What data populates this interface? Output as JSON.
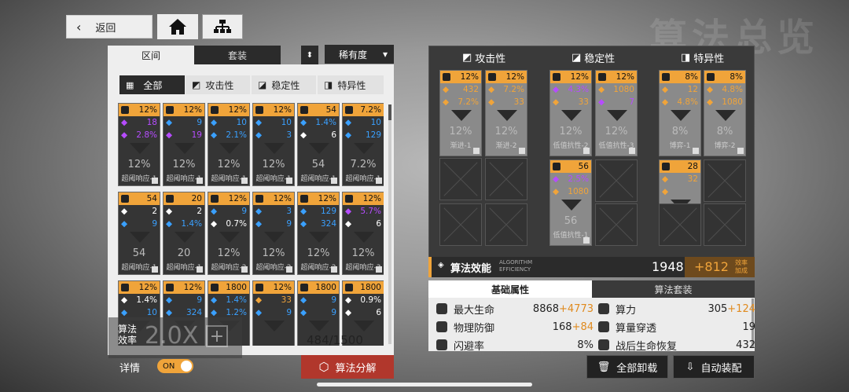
{
  "bg_title": "算法总览",
  "nav": {
    "back_label": "返回"
  },
  "left": {
    "tabs": [
      "区间",
      "套装"
    ],
    "sort_label": "稀有度",
    "filters": [
      "全部",
      "攻击性",
      "稳定性",
      "特异性"
    ],
    "count": "484/1500",
    "detail_label": "详情",
    "toggle_label": "ON",
    "decompose_label": "算法分解",
    "boost_label": "算法效率",
    "boost_value": "2.0X"
  },
  "cards": [
    {
      "h": "12%",
      "l1": "18",
      "l2": "2.8%",
      "big": "12%",
      "name": "超阈响应-1"
    },
    {
      "h": "12%",
      "l1": "9",
      "l2": "19",
      "big": "12%",
      "name": "超阈响应-1"
    },
    {
      "h": "12%",
      "l1": "10",
      "l2": "2.1%",
      "big": "12%",
      "name": "超阈响应-1"
    },
    {
      "h": "12%",
      "l1": "10",
      "l2": "3",
      "big": "12%",
      "name": "超阈响应-1"
    },
    {
      "h": "54",
      "l1": "1.4%",
      "l2": "6",
      "big": "54",
      "name": "超阈响应-1"
    },
    {
      "h": "7.2%",
      "l1": "10",
      "l2": "129",
      "big": "7.2%",
      "name": "超阈响应-1"
    },
    {
      "h": "54",
      "l1": "2",
      "l2": "9",
      "big": "54",
      "name": "超阈响应-1"
    },
    {
      "h": "20",
      "l1": "2",
      "l2": "1.4%",
      "big": "20",
      "name": "超阈响应-1"
    },
    {
      "h": "12%",
      "l1": "9",
      "l2": "0.7%",
      "big": "12%",
      "name": "超阈响应-2"
    },
    {
      "h": "12%",
      "l1": "3",
      "l2": "9",
      "big": "12%",
      "name": "超阈响应-2"
    },
    {
      "h": "12%",
      "l1": "129",
      "l2": "324",
      "big": "12%",
      "name": "超阈响应-2"
    },
    {
      "h": "12%",
      "l1": "5.7%",
      "l2": "6",
      "big": "12%",
      "name": "超阈响应-3"
    },
    {
      "h": "12%",
      "l1": "1.4%",
      "l2": "10",
      "big": "",
      "name": ""
    },
    {
      "h": "12%",
      "l1": "9",
      "l2": "324",
      "big": "",
      "name": ""
    },
    {
      "h": "1800",
      "l1": "1.4%",
      "l2": "1.2%",
      "big": "",
      "name": ""
    },
    {
      "h": "12%",
      "l1": "33",
      "l2": "9",
      "big": "",
      "name": ""
    },
    {
      "h": "1800",
      "l1": "9",
      "l2": "9",
      "big": "",
      "name": ""
    },
    {
      "h": "1800",
      "l1": "0.9%",
      "l2": "6",
      "big": "",
      "name": ""
    }
  ],
  "right": {
    "col_titles": [
      "攻击性",
      "稳定性",
      "特异性"
    ],
    "slots": [
      {
        "h": "12%",
        "l1": "432",
        "l2": "7.2%",
        "big": "12%",
        "name": "渐进-1"
      },
      {
        "h": "12%",
        "l1": "7.2%",
        "l2": "33",
        "big": "12%",
        "name": "渐进-2"
      },
      {
        "h": "12%",
        "l1": "4.3%",
        "l2": "33",
        "big": "12%",
        "name": "低值抗性-2"
      },
      {
        "h": "12%",
        "l1": "1080",
        "l2": "7",
        "big": "12%",
        "name": "低值抗性-3"
      },
      {
        "h": "56",
        "l1": "2.5%",
        "l2": "1080",
        "big": "56",
        "name": "低值抗性-1"
      },
      {
        "h": "8%",
        "l1": "12",
        "l2": "4.8%",
        "big": "8%",
        "name": "博弈-1"
      },
      {
        "h": "8%",
        "l1": "4.8%",
        "l2": "1080",
        "big": "8%",
        "name": "博弈-2"
      },
      {
        "h": "28",
        "l1": "32",
        "l2": "",
        "big": "",
        "name": ""
      }
    ],
    "eff_label": "算法效能",
    "eff_sub": "ALGORITHM EFFICIENCY",
    "eff_value": "1948",
    "eff_bonus": "+812",
    "eff_bonus_label": "效率加成",
    "tabs": [
      "基础属性",
      "算法套装"
    ],
    "stats_left": [
      {
        "k": "最大生命",
        "v": "8868",
        "b": "+4773"
      },
      {
        "k": "物理防御",
        "v": "168",
        "b": "+84"
      },
      {
        "k": "闪避率",
        "v": "8%",
        "b": ""
      }
    ],
    "stats_right": [
      {
        "k": "算力",
        "v": "305",
        "b": "+124"
      },
      {
        "k": "算量穿透",
        "v": "19",
        "b": ""
      },
      {
        "k": "战后生命恢复",
        "v": "432",
        "b": ""
      }
    ],
    "unload_label": "全部卸载",
    "auto_label": "自动装配"
  },
  "colors": {
    "accent": "#f0a43a",
    "purple": "#b64cff",
    "blue": "#3aa0ff",
    "red": "#b1372c"
  }
}
